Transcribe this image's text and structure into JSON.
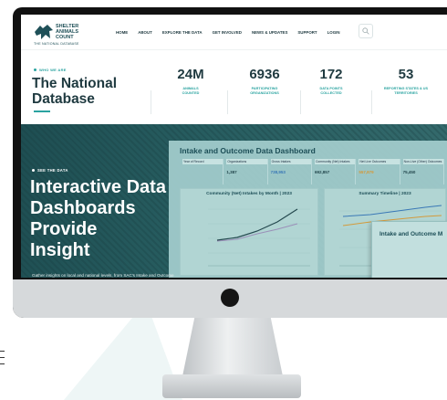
{
  "logo": {
    "line1": "SHELTER",
    "line2": "ANIMALS",
    "line3": "COUNT",
    "tagline": "THE NATIONAL DATABASE",
    "mark_color": "#1f5058"
  },
  "nav": [
    "HOME",
    "ABOUT",
    "EXPLORE THE DATA",
    "GET INVOLVED",
    "NEWS & UPDATES",
    "SUPPORT",
    "LOGIN"
  ],
  "search": {
    "icon": "search-icon"
  },
  "intro": {
    "kicker": "WHO WE ARE",
    "title_line1": "The National",
    "title_line2": "Database"
  },
  "stats": [
    {
      "value": "24M",
      "label1": "ANIMALS",
      "label2": "COUNTED"
    },
    {
      "value": "6936",
      "label1": "PARTICIPATING",
      "label2": "ORGANIZATIONS"
    },
    {
      "value": "172",
      "label1": "DATA POINTS",
      "label2": "COLLECTED"
    },
    {
      "value": "53",
      "label1": "REPORTING STATES & US",
      "label2": "TERRITORIES"
    }
  ],
  "hero": {
    "kicker": "SEE THE DATA",
    "title_lines": [
      "Interactive Data",
      "Dashboards",
      "Provide",
      "Insight"
    ],
    "subtitle": "Gather insights on local and national levels, from SAC's Intake and Outcome"
  },
  "dashboard": {
    "title": "Intake and Outcome Data Dashboard",
    "kpi_headers": [
      "Year of Record",
      "Organizations",
      "Gross Intakes",
      "Community (Net) Intakes",
      "Net Live Outcomes",
      "Non-Live (Other) Outcomes"
    ],
    "kpi_values": [
      "",
      "1,387",
      "738,953",
      "692,857",
      "557,879",
      "75,450"
    ],
    "panel1_title": "Community (Net) Intakes by Month | 2023",
    "panel2_title": "Summary Timeline | 2023",
    "card_title": "Intake and Outcome M",
    "colors": {
      "teal": "#1f5058",
      "accent": "#2aa3a0",
      "blue": "#3a78b6",
      "orange": "#d39a3b"
    }
  }
}
